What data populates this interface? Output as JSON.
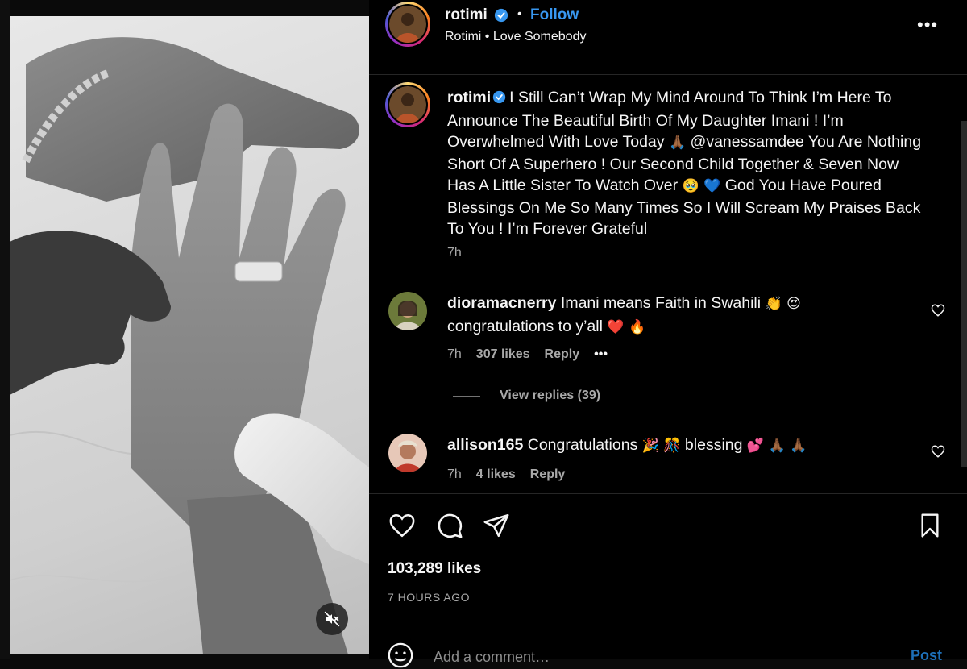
{
  "post": {
    "username": "rotimi",
    "verified": true,
    "follow_label": "Follow",
    "separator": "•",
    "audio": "Rotimi • Love Somebody",
    "more_label": "•••"
  },
  "caption": {
    "username": "rotimi",
    "text_1": "I Still Can’t Wrap My Mind Around To Think I’m Here To Announce The Beautiful Birth Of My Daughter Imani ! I’m Overwhelmed With Love Today",
    "emoji_1": "🙏🏾",
    "mention": "@vanessamdee",
    "text_2": "You Are Nothing Short Of A Superhero ! Our Second Child Together & Seven Now Has A Little Sister To Watch Over",
    "emoji_2": "🥹 💙",
    "text_3": "God You Have Poured Blessings On Me So Many Times So I Will Scream My Praises Back To You ! I’m Forever Grateful",
    "time": "7h"
  },
  "comments": [
    {
      "username": "dioramacnerry",
      "text": "Imani means Faith in Swahili",
      "emoji_inline": "👏 😍",
      "line2": "congratulations to y’all",
      "emoji_line2": "❤️ 🔥",
      "time": "7h",
      "likes": "307 likes",
      "reply_label": "Reply",
      "more_label": "•••"
    },
    {
      "username": "allison165",
      "text": "Congratulations",
      "emoji_1": "🎉 🎊",
      "text_2": "blessing",
      "emoji_2": "💕 🙏🏾 🙏🏾",
      "time": "7h",
      "likes": "4 likes",
      "reply_label": "Reply"
    }
  ],
  "view_replies_label": "View replies (39)",
  "likes_count": "103,289 likes",
  "time_ago": "7 HOURS AGO",
  "comment_input": {
    "placeholder": "Add a comment…",
    "post_label": "Post"
  },
  "colors": {
    "accent": "#3897f0",
    "verified": "#3797f0",
    "muted": "#a8a8a8"
  }
}
